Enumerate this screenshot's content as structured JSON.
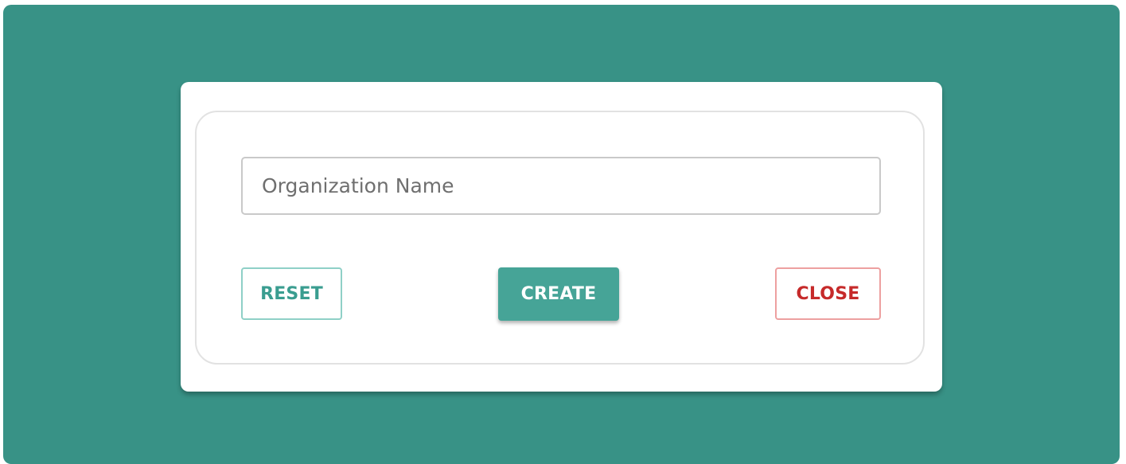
{
  "form": {
    "organization_name": {
      "value": "",
      "placeholder": "Organization Name"
    },
    "buttons": {
      "reset_label": "RESET",
      "create_label": "CREATE",
      "close_label": "CLOSE"
    }
  },
  "colors": {
    "backdrop": "#389286",
    "primary": "#46a497",
    "danger": "#c62a2a"
  }
}
